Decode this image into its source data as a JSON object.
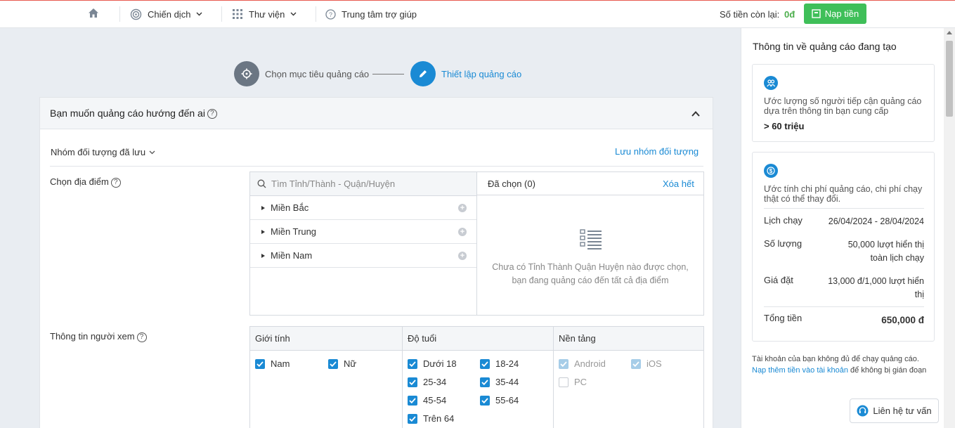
{
  "topbar": {
    "campaign_label": "Chiến dịch",
    "library_label": "Thư viện",
    "help_center_label": "Trung tâm trợ giúp",
    "balance_label": "Số tiền còn lại:",
    "balance_value": "0đ",
    "topup_label": "Nạp tiền"
  },
  "stepper": {
    "step1_label": "Chọn mục tiêu quảng cáo",
    "step2_label": "Thiết lập quảng cáo"
  },
  "audience": {
    "title": "Bạn muốn quảng cáo hướng đến ai",
    "saved_groups_label": "Nhóm đối tượng đã lưu",
    "save_group_link": "Lưu nhóm đối tượng",
    "location_label": "Chọn địa điểm",
    "search_placeholder": "Tìm Tỉnh/Thành - Quận/Huyện",
    "regions": [
      "Miền Bắc",
      "Miền Trung",
      "Miền Nam"
    ],
    "selected_title": "Đã chọn (0)",
    "clear_all": "Xóa hết",
    "empty_text_line1": "Chưa có Tỉnh Thành Quận Huyện nào được chọn,",
    "empty_text_line2": "bạn đang quảng cáo đến tất cả địa điểm",
    "viewer_label": "Thông tin người xem",
    "gender_head": "Giới tính",
    "age_head": "Độ tuổi",
    "platform_head": "Nền tảng",
    "genders": [
      "Nam",
      "Nữ"
    ],
    "ages": [
      "Dưới 18",
      "18-24",
      "25-34",
      "35-44",
      "45-54",
      "55-64",
      "Trên 64"
    ],
    "platforms": [
      "Android",
      "iOS",
      "PC"
    ]
  },
  "sidebar": {
    "title": "Thông tin về quảng cáo đang tạo",
    "reach_desc": "Ước lượng số người tiếp cận quảng cáo dựa trên thông tin bạn cung cấp",
    "reach_value": "> 60 triệu",
    "cost_desc": "Ước tính chi phí quảng cáo, chi phí chạy thật có thể thay đổi.",
    "schedule_key": "Lịch chạy",
    "schedule_val": "26/04/2024 - 28/04/2024",
    "quantity_key": "Số lượng",
    "quantity_val_1": "50,000 lượt hiển thị",
    "quantity_val_2": "toàn lịch chạy",
    "bid_key": "Giá đặt",
    "bid_val_1": "13,000 đ/1,000 lượt hiển",
    "bid_val_2": "thị",
    "total_key": "Tổng tiền",
    "total_val": "650,000 đ",
    "note_text": "Tài khoản của bạn không đủ để chạy quảng cáo.",
    "note_link": "Nạp thêm tiền vào tài khoản",
    "note_suffix": " để không bị gián đoạn",
    "contact_label": "Liên hệ tư vấn"
  },
  "colors": {
    "accent": "#1a8ad4",
    "topup_green": "#3fbf59",
    "balance_green": "#4cae4c"
  }
}
